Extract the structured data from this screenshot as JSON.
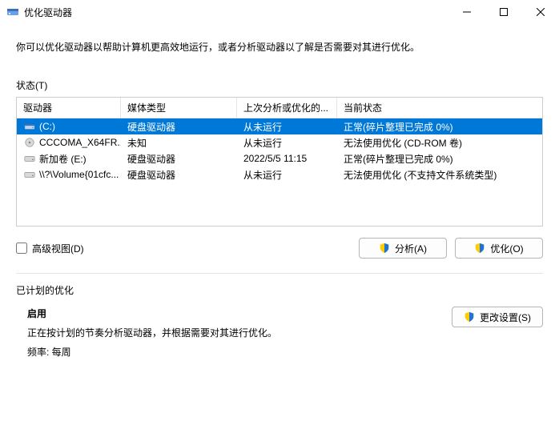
{
  "window": {
    "title": "优化驱动器"
  },
  "description": "你可以优化驱动器以帮助计算机更高效地运行，或者分析驱动器以了解是否需要对其进行优化。",
  "status_label": "状态(T)",
  "columns": {
    "drive": "驱动器",
    "media": "媒体类型",
    "last": "上次分析或优化的...",
    "status": "当前状态"
  },
  "rows": [
    {
      "icon": "drive-c",
      "drive": "(C:)",
      "media": "硬盘驱动器",
      "last": "从未运行",
      "status": "正常(碎片整理已完成 0%)",
      "selected": true
    },
    {
      "icon": "disc",
      "drive": "CCCOMA_X64FR...",
      "media": "未知",
      "last": "从未运行",
      "status": "无法使用优化 (CD-ROM 卷)",
      "selected": false
    },
    {
      "icon": "drive",
      "drive": "新加卷 (E:)",
      "media": "硬盘驱动器",
      "last": "2022/5/5 11:15",
      "status": "正常(碎片整理已完成 0%)",
      "selected": false
    },
    {
      "icon": "drive",
      "drive": "\\\\?\\Volume{01cfc...",
      "media": "硬盘驱动器",
      "last": "从未运行",
      "status": "无法使用优化 (不支持文件系统类型)",
      "selected": false
    }
  ],
  "advanced_view_label": "高级视图(D)",
  "buttons": {
    "analyze": "分析(A)",
    "optimize": "优化(O)",
    "change_settings": "更改设置(S)"
  },
  "scheduled": {
    "title": "已计划的优化",
    "enabled_label": "启用",
    "desc": "正在按计划的节奏分析驱动器，并根据需要对其进行优化。",
    "freq": "频率: 每周"
  }
}
